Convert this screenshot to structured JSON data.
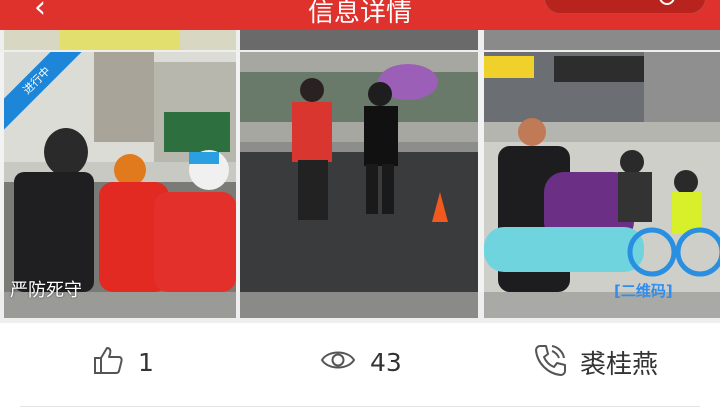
{
  "header": {
    "back_icon": "chevron-left-icon",
    "title": "信息详情",
    "accent_color": "#e0322c"
  },
  "gallery": {
    "status_ribbon": "进行中",
    "caption_left": "严防死守",
    "caption_right": "[二维码]",
    "ribbon_color": "#1e86d8"
  },
  "stats": {
    "likes_icon": "thumbs-up-icon",
    "likes": "1",
    "views_icon": "eye-icon",
    "views": "43",
    "phone_icon": "phone-icon",
    "contact_name": "裘桂燕"
  }
}
